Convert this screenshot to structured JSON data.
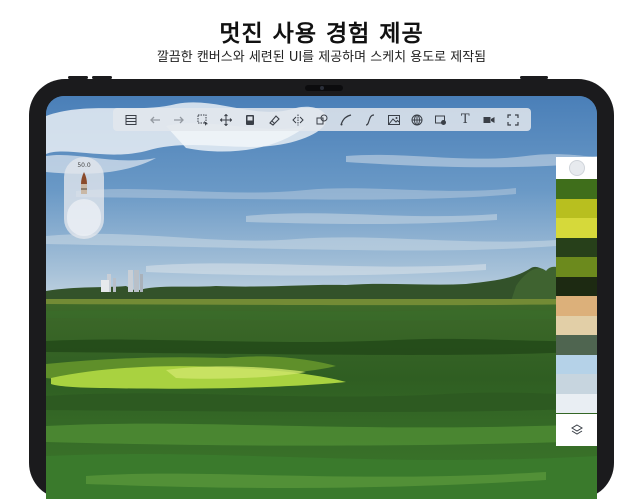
{
  "header": {
    "title": "멋진 사용 경험 제공",
    "subtitle": "깔끔한 캔버스와 세련된 UI를 제공하며 스케치 용도로 제작됨"
  },
  "toolbar": {
    "tools": [
      {
        "icon": "layers-list-icon"
      },
      {
        "icon": "undo-icon"
      },
      {
        "icon": "redo-icon"
      },
      {
        "icon": "selection-icon"
      },
      {
        "icon": "move-icon"
      },
      {
        "icon": "document-icon"
      },
      {
        "icon": "eraser-icon"
      },
      {
        "icon": "symmetry-icon"
      },
      {
        "icon": "shapes-icon"
      },
      {
        "icon": "curve-icon"
      },
      {
        "icon": "s-curve-icon"
      },
      {
        "icon": "image-icon"
      },
      {
        "icon": "perspective-grid-icon"
      },
      {
        "icon": "stencil-icon"
      },
      {
        "icon": "text-icon",
        "label": "T"
      },
      {
        "icon": "video-icon"
      },
      {
        "icon": "fullscreen-icon"
      }
    ]
  },
  "brush": {
    "size": "50.0",
    "color": "#8a4a2a"
  },
  "palette": {
    "swatches": [
      "#3f6e1b",
      "#b8bf1f",
      "#d6d93a",
      "#27401a",
      "#6c8a1d",
      "#1d2a12",
      "#dcb07a",
      "#e2cfa7",
      "#4f6550",
      "#b5d2e8",
      "#c7d5df",
      "#e9eef3"
    ]
  },
  "colors": {
    "sky_top": "#4f82b9",
    "field": "#2d5f23",
    "accent_grass": "#a9d240"
  }
}
